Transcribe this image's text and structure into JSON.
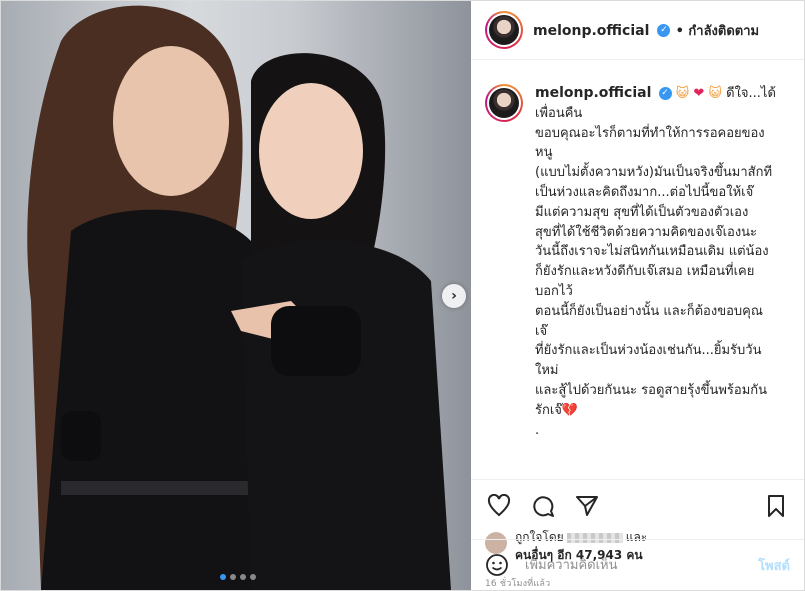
{
  "account": {
    "username": "melonp.official",
    "follow_status": "• กำลังติดตาม",
    "verified_icon": "verified-badge-icon"
  },
  "media": {
    "carousel_dots": 4,
    "active_dot": 0,
    "next_icon": "chevron-right-icon"
  },
  "caption": {
    "username": "melonp.official",
    "emojis": [
      "😺",
      "❤",
      "😺"
    ],
    "lines": [
      "ดีใจ...ได้",
      "เพื่อนคืน",
      "ขอบคุณอะไรก็ตามที่ทำให้การรอคอยของ",
      "หนู",
      "(แบบไม่ตั้งความหวัง)มันเป็นจริงขึ้นมาสักที",
      "เป็นห่วงและคิดถึงมาก...ต่อไปนี้ขอให้เจ๊",
      "มีแต่ความสุข สุขที่ได้เป็นตัวของตัวเอง",
      "สุขที่ได้ใช้ชีวิตด้วยความคิดของเจ๊เองนะ",
      "วันนี้ถึงเราจะไม่สนิทกันเหมือนเดิม แต่น้อง",
      "ก็ยังรักและหวังดีกับเจ๊เสมอ เหมือนที่เคย",
      "บอกไว้",
      "ตอนนี้ก็ยังเป็นอย่างนั้น และก็ต้องขอบคุณ",
      "เจ๊",
      "ที่ยังรักและเป็นห่วงน้องเช่นกัน...ยิ้มรับวัน",
      "ใหม่",
      "และสู้ไปด้วยกันนะ รอดูสายรุ้งขึ้นพร้อมกัน",
      "รักเจ๊💔",
      "."
    ]
  },
  "actions": {
    "like_icon": "heart-icon",
    "comment_icon": "comment-icon",
    "share_icon": "share-icon",
    "save_icon": "bookmark-icon"
  },
  "likes": {
    "liked_by": "ถูกใจโดย",
    "and": "และ",
    "others": "คนอื่นๆ อีก 47,943 คน"
  },
  "timestamp": "16 ชั่วโมงที่แล้ว",
  "comment": {
    "placeholder": "เพิ่มความคิดเห็น",
    "post_label": "โพสต์",
    "emoji_icon": "smiley-icon"
  },
  "colors": {
    "link_blue": "#3897f0",
    "post_disabled": "#b2dffc",
    "border": "#dbdbdb"
  }
}
